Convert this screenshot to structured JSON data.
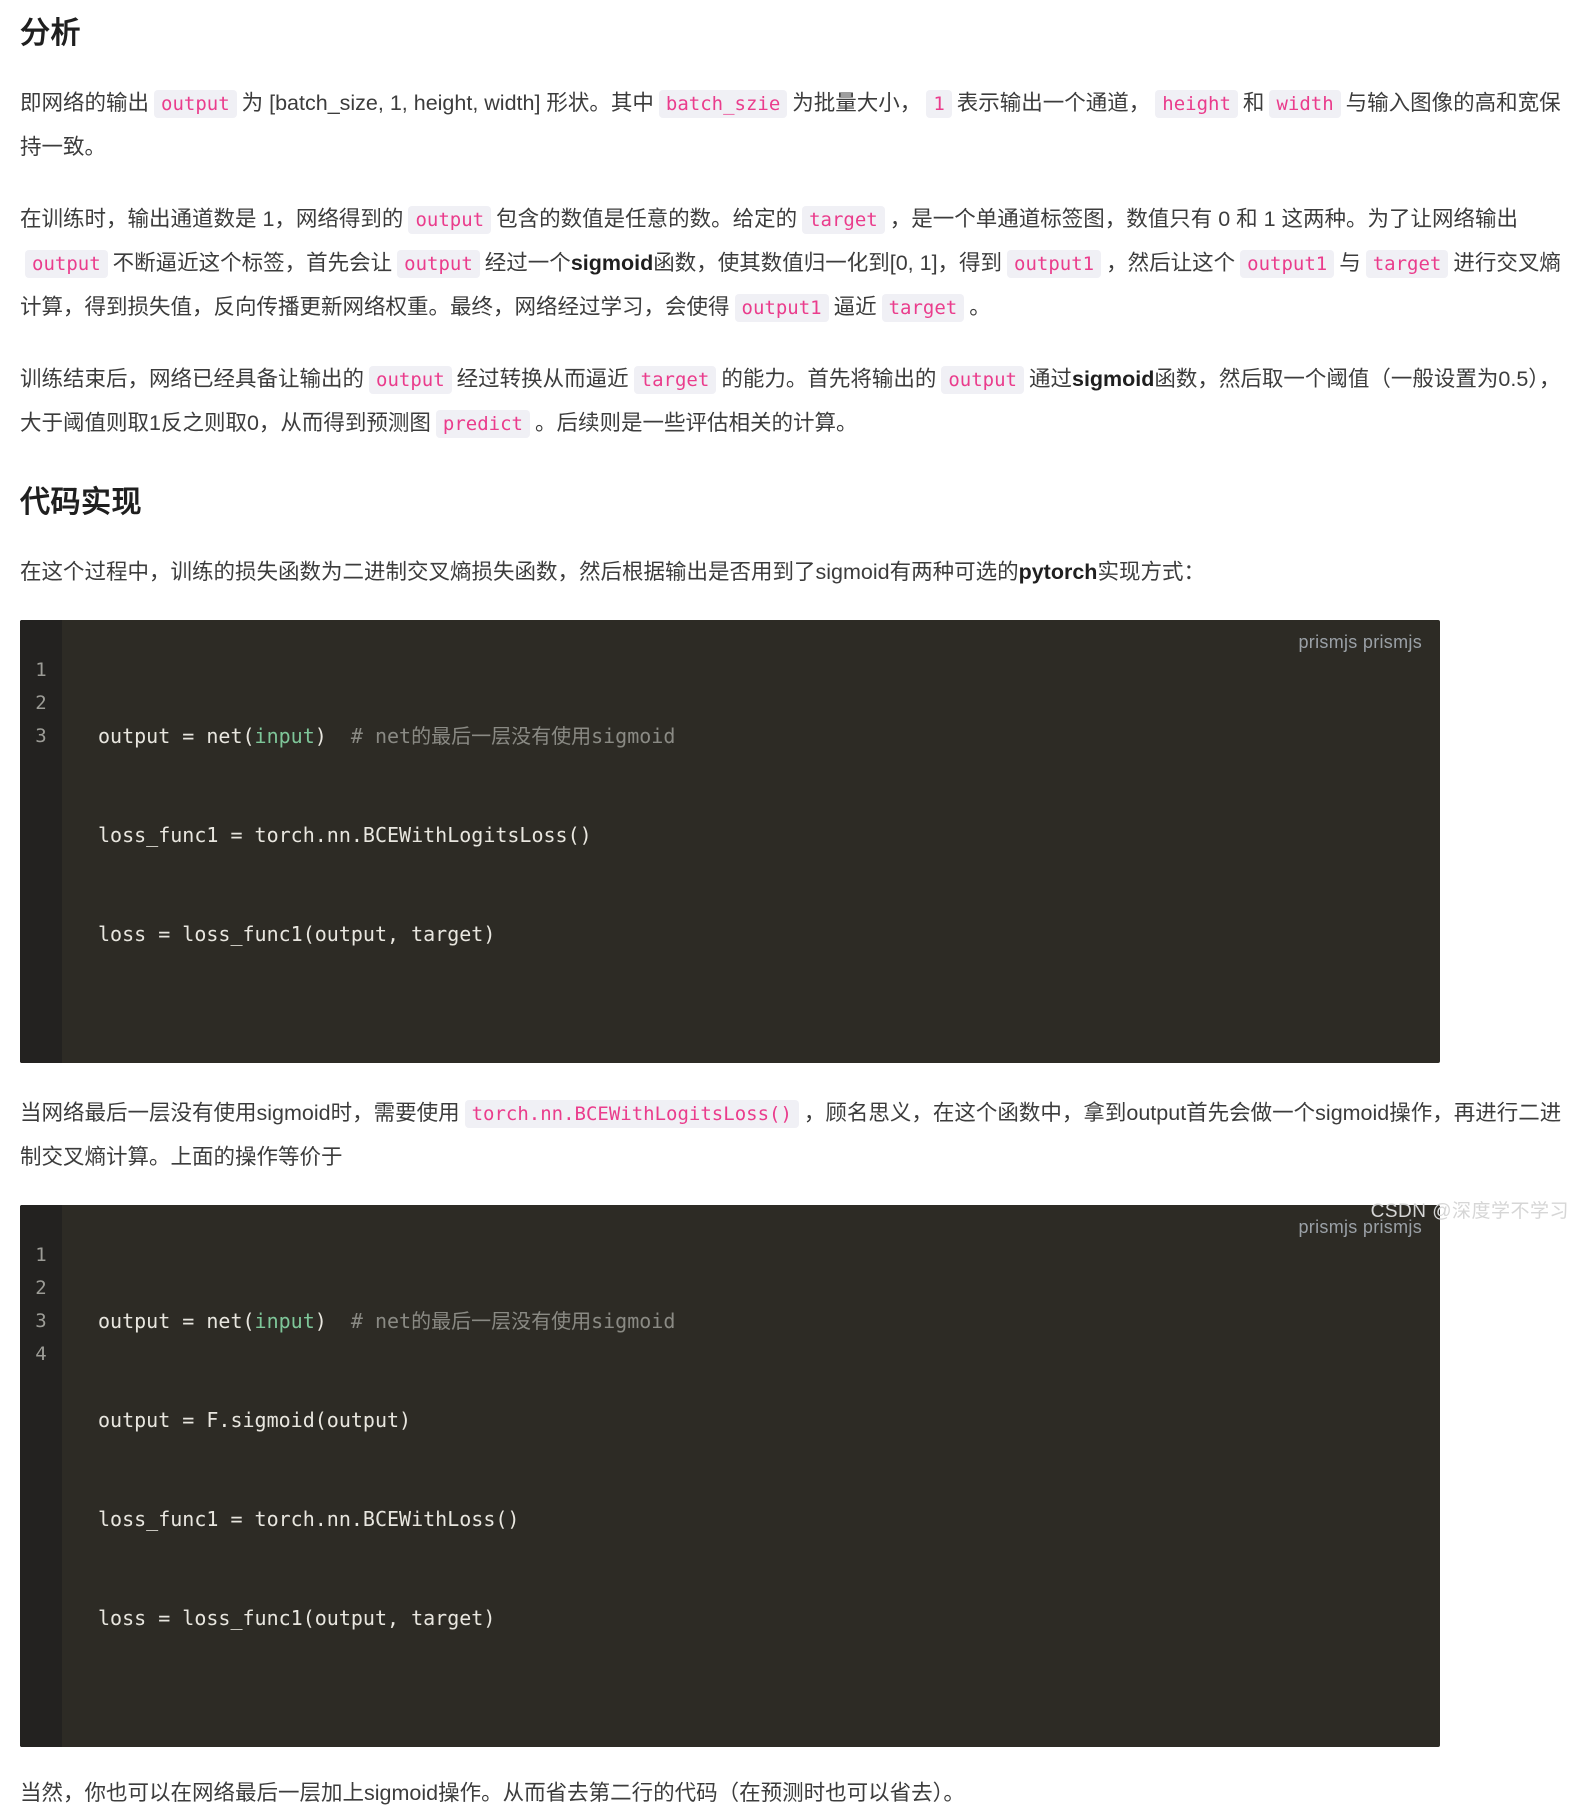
{
  "sections": {
    "analysis_title": "分析",
    "code_title": "代码实现"
  },
  "paragraphs": {
    "p1": {
      "t1": "即网络的输出",
      "c1": "output",
      "t2": "为 [batch_size, 1, height, width] 形状。其中",
      "c2": "batch_szie",
      "t3": "为批量大小，",
      "c3": "1",
      "t4": "表示输出一个通道，",
      "c4": "height",
      "t5": "和",
      "c5": "width",
      "t6": "与输入图像的高和宽保持一致。"
    },
    "p2": {
      "t1": "在训练时，输出通道数是 1，网络得到的",
      "c1": "output",
      "t2": "包含的数值是任意的数。给定的",
      "c2": "target",
      "t3": "，是一个单通道标签图，数值只有 0 和 1 这两种。为了让网络输出",
      "c3": "output",
      "t4": "不断逼近这个标签，首先会让",
      "c4": "output",
      "t5": "经过一个",
      "b1": "sigmoid",
      "t6": "函数，使其数值归一化到[0, 1]，得到",
      "c5": "output1",
      "t7": "，然后让这个",
      "c6": "output1",
      "t8": "与",
      "c7": "target",
      "t9": "进行交叉熵计算，得到损失值，反向传播更新网络权重。最终，网络经过学习，会使得",
      "c8": "output1",
      "t10": "逼近",
      "c9": "target",
      "t11": "。"
    },
    "p3": {
      "t1": "训练结束后，网络已经具备让输出的",
      "c1": "output",
      "t2": "经过转换从而逼近",
      "c2": "target",
      "t3": "的能力。首先将输出的",
      "c3": "output",
      "t4": "通过",
      "b1": "sigmoid",
      "t5": "函数，然后取一个阈值（一般设置为0.5），大于阈值则取1反之则取0，从而得到预测图",
      "c4": "predict",
      "t6": "。后续则是一些评估相关的计算。"
    },
    "p4": {
      "t1": "在这个过程中，训练的损失函数为二进制交叉熵损失函数，然后根据输出是否用到了sigmoid有两种可选的",
      "b1": "pytorch",
      "t2": "实现方式："
    },
    "p5": {
      "t1": "当网络最后一层没有使用sigmoid时，需要使用",
      "c1": "torch.nn.BCEWithLogitsLoss()",
      "t2": "，顾名思义，在这个函数中，拿到output首先会做一个sigmoid操作，再进行二进制交叉熵计算。上面的操作等价于"
    },
    "p6": {
      "t1": "当然，你也可以在网络最后一层加上sigmoid操作。从而省去第二行的代码（在预测时也可以省去）。"
    }
  },
  "code_blocks": [
    {
      "tag": "prismjs prismjs",
      "line_numbers": [
        "1",
        "2",
        "3"
      ],
      "lines": [
        {
          "pre": "output = net(",
          "param": "input",
          "post": ")  ",
          "comment": "# net的最后一层没有使用sigmoid"
        },
        {
          "pre": "loss_func1 = torch.nn.BCEWithLogitsLoss()",
          "param": "",
          "post": "",
          "comment": ""
        },
        {
          "pre": "loss = loss_func1(output, target)",
          "param": "",
          "post": "",
          "comment": ""
        }
      ]
    },
    {
      "tag": "prismjs prismjs",
      "line_numbers": [
        "1",
        "2",
        "3",
        "4"
      ],
      "lines": [
        {
          "pre": "output = net(",
          "param": "input",
          "post": ")  ",
          "comment": "# net的最后一层没有使用sigmoid"
        },
        {
          "pre": "output = F.sigmoid(output)",
          "param": "",
          "post": "",
          "comment": ""
        },
        {
          "pre": "loss_func1 = torch.nn.BCEWithLoss()",
          "param": "",
          "post": "",
          "comment": ""
        },
        {
          "pre": "loss = loss_func1(output, target)",
          "param": "",
          "post": "",
          "comment": ""
        }
      ]
    }
  ],
  "watermark": "CSDN @深度学不学习",
  "colors": {
    "chip_bg": "#f0f0f5",
    "chip_text": "#ea3c8c",
    "code_bg": "#2d2b25",
    "gutter_bg": "#232220",
    "param_green": "#7ec699",
    "comment_gray": "#8a8a84"
  }
}
